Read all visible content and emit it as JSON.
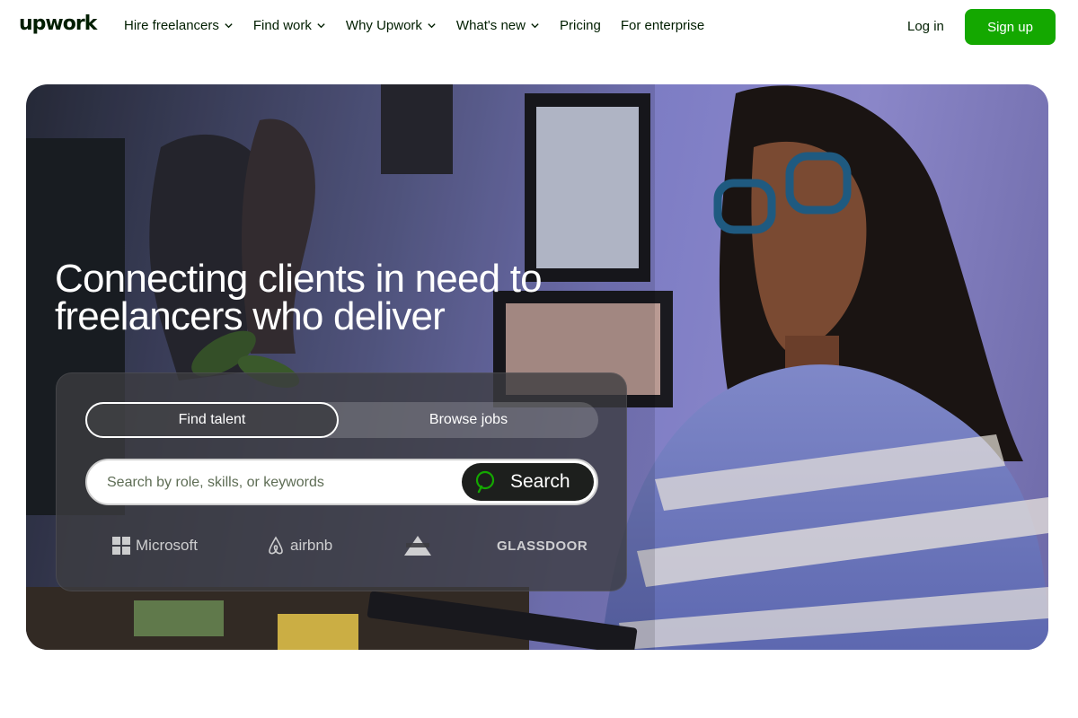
{
  "header": {
    "logo": "upwork",
    "nav": [
      {
        "label": "Hire freelancers",
        "dropdown": true
      },
      {
        "label": "Find work",
        "dropdown": true
      },
      {
        "label": "Why Upwork",
        "dropdown": true
      },
      {
        "label": "What's new",
        "dropdown": true
      },
      {
        "label": "Pricing",
        "dropdown": false
      },
      {
        "label": "For enterprise",
        "dropdown": false
      }
    ],
    "login_label": "Log in",
    "signup_label": "Sign up"
  },
  "hero": {
    "title_line1": "Connecting clients in need to",
    "title_line2": "freelancers who deliver",
    "tabs": {
      "active": "Find talent",
      "inactive": "Browse jobs"
    },
    "search": {
      "placeholder": "Search by role, skills, or keywords",
      "value": "",
      "button_label": "Search"
    },
    "trusted_by": [
      {
        "name": "Microsoft",
        "icon": "microsoft-logo"
      },
      {
        "name": "airbnb",
        "icon": "airbnb-logo"
      },
      {
        "name": "",
        "icon": "bissell-logo"
      },
      {
        "name": "GLASSDOOR",
        "icon": "glassdoor-logo"
      }
    ]
  },
  "colors": {
    "brand_green": "#14a800",
    "text_dark": "#001e00",
    "search_button": "#1d1f1d"
  }
}
